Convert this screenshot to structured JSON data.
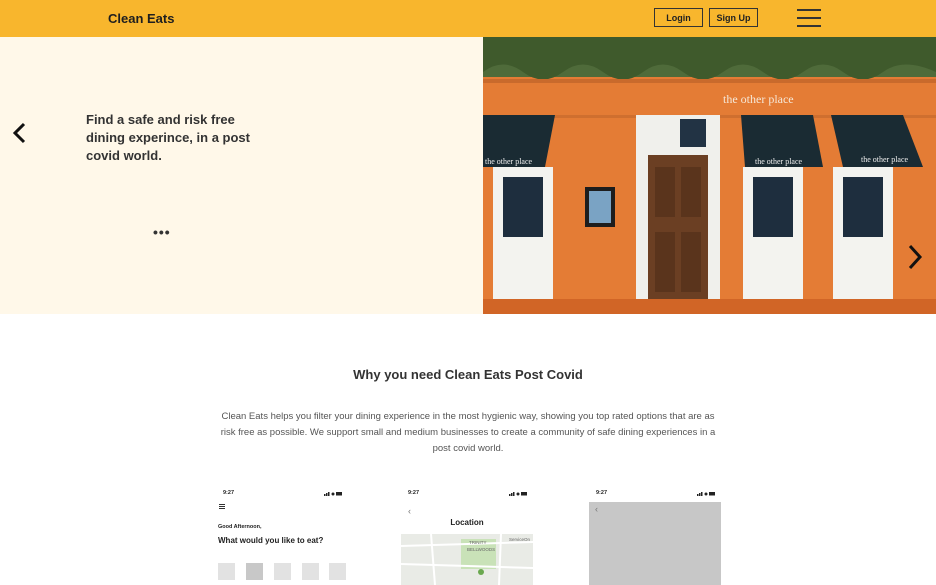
{
  "header": {
    "brand": "Clean Eats",
    "login_label": "Login",
    "signup_label": "Sign Up"
  },
  "hero": {
    "text": "Find a safe and risk free dining experince, in a post covid world.",
    "dots": "•••",
    "image_sign": "the other place",
    "awning_text": "the other place"
  },
  "why": {
    "title": "Why you need Clean Eats Post Covid",
    "description": "Clean Eats helps you filter your dining experience in the most hygienic way, showing you top rated options that are as risk free as possible. We support small and medium businesses to create a community of safe dining experiences in a post covid world."
  },
  "phones": [
    {
      "time": "9:27",
      "greeting": "Good Afternoon,",
      "question": "What would you like to eat?"
    },
    {
      "time": "9:27",
      "title": "Location",
      "map_label_1": "TRINITY",
      "map_label_2": "BELLWOODS",
      "map_label_3": "ServiceOn"
    },
    {
      "time": "9:27"
    }
  ],
  "colors": {
    "header": "#f8b62d",
    "hero_bg": "#fff8e9",
    "storefront": "#e5803a"
  }
}
